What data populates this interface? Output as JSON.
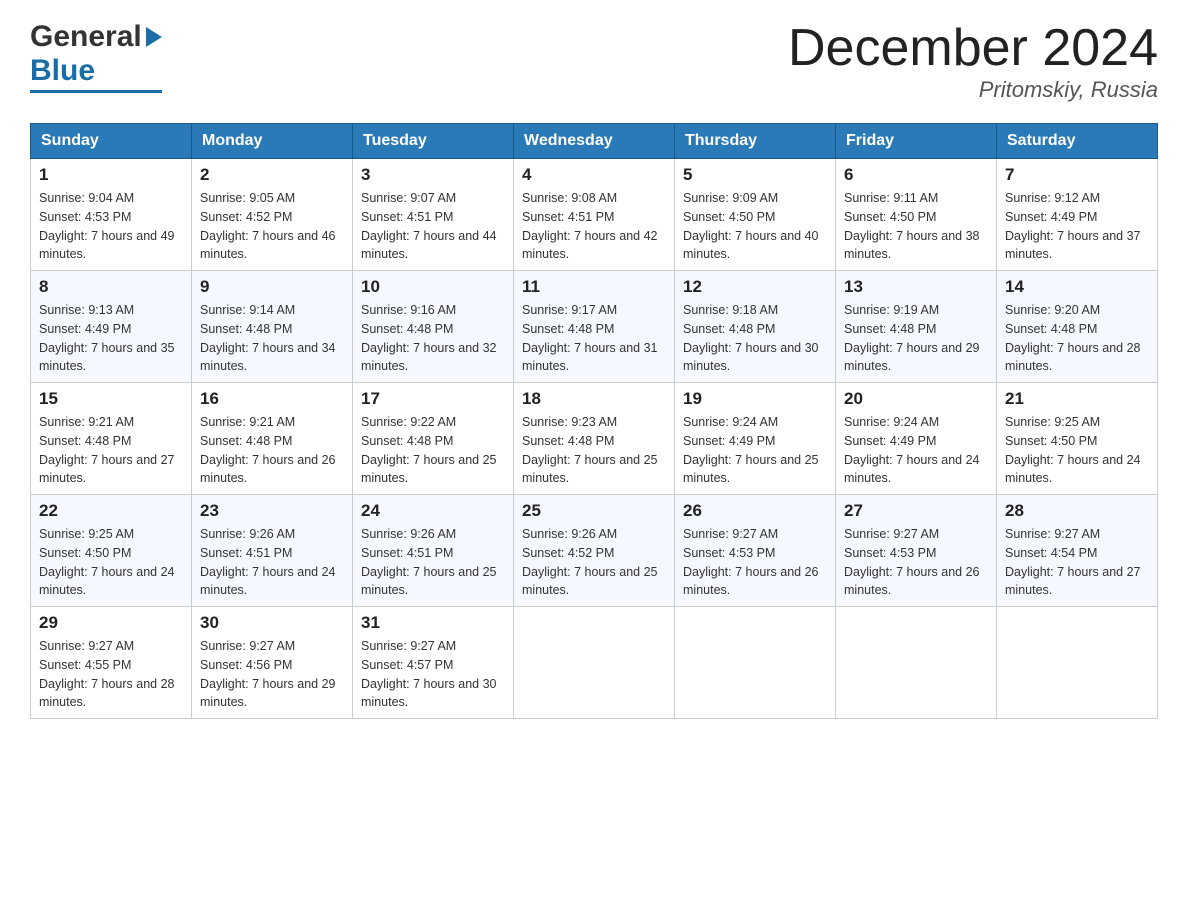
{
  "header": {
    "logo_general": "General",
    "logo_blue": "Blue",
    "month_title": "December 2024",
    "location": "Pritomskiy, Russia"
  },
  "days_of_week": [
    "Sunday",
    "Monday",
    "Tuesday",
    "Wednesday",
    "Thursday",
    "Friday",
    "Saturday"
  ],
  "weeks": [
    [
      {
        "date": "1",
        "sunrise": "Sunrise: 9:04 AM",
        "sunset": "Sunset: 4:53 PM",
        "daylight": "Daylight: 7 hours and 49 minutes."
      },
      {
        "date": "2",
        "sunrise": "Sunrise: 9:05 AM",
        "sunset": "Sunset: 4:52 PM",
        "daylight": "Daylight: 7 hours and 46 minutes."
      },
      {
        "date": "3",
        "sunrise": "Sunrise: 9:07 AM",
        "sunset": "Sunset: 4:51 PM",
        "daylight": "Daylight: 7 hours and 44 minutes."
      },
      {
        "date": "4",
        "sunrise": "Sunrise: 9:08 AM",
        "sunset": "Sunset: 4:51 PM",
        "daylight": "Daylight: 7 hours and 42 minutes."
      },
      {
        "date": "5",
        "sunrise": "Sunrise: 9:09 AM",
        "sunset": "Sunset: 4:50 PM",
        "daylight": "Daylight: 7 hours and 40 minutes."
      },
      {
        "date": "6",
        "sunrise": "Sunrise: 9:11 AM",
        "sunset": "Sunset: 4:50 PM",
        "daylight": "Daylight: 7 hours and 38 minutes."
      },
      {
        "date": "7",
        "sunrise": "Sunrise: 9:12 AM",
        "sunset": "Sunset: 4:49 PM",
        "daylight": "Daylight: 7 hours and 37 minutes."
      }
    ],
    [
      {
        "date": "8",
        "sunrise": "Sunrise: 9:13 AM",
        "sunset": "Sunset: 4:49 PM",
        "daylight": "Daylight: 7 hours and 35 minutes."
      },
      {
        "date": "9",
        "sunrise": "Sunrise: 9:14 AM",
        "sunset": "Sunset: 4:48 PM",
        "daylight": "Daylight: 7 hours and 34 minutes."
      },
      {
        "date": "10",
        "sunrise": "Sunrise: 9:16 AM",
        "sunset": "Sunset: 4:48 PM",
        "daylight": "Daylight: 7 hours and 32 minutes."
      },
      {
        "date": "11",
        "sunrise": "Sunrise: 9:17 AM",
        "sunset": "Sunset: 4:48 PM",
        "daylight": "Daylight: 7 hours and 31 minutes."
      },
      {
        "date": "12",
        "sunrise": "Sunrise: 9:18 AM",
        "sunset": "Sunset: 4:48 PM",
        "daylight": "Daylight: 7 hours and 30 minutes."
      },
      {
        "date": "13",
        "sunrise": "Sunrise: 9:19 AM",
        "sunset": "Sunset: 4:48 PM",
        "daylight": "Daylight: 7 hours and 29 minutes."
      },
      {
        "date": "14",
        "sunrise": "Sunrise: 9:20 AM",
        "sunset": "Sunset: 4:48 PM",
        "daylight": "Daylight: 7 hours and 28 minutes."
      }
    ],
    [
      {
        "date": "15",
        "sunrise": "Sunrise: 9:21 AM",
        "sunset": "Sunset: 4:48 PM",
        "daylight": "Daylight: 7 hours and 27 minutes."
      },
      {
        "date": "16",
        "sunrise": "Sunrise: 9:21 AM",
        "sunset": "Sunset: 4:48 PM",
        "daylight": "Daylight: 7 hours and 26 minutes."
      },
      {
        "date": "17",
        "sunrise": "Sunrise: 9:22 AM",
        "sunset": "Sunset: 4:48 PM",
        "daylight": "Daylight: 7 hours and 25 minutes."
      },
      {
        "date": "18",
        "sunrise": "Sunrise: 9:23 AM",
        "sunset": "Sunset: 4:48 PM",
        "daylight": "Daylight: 7 hours and 25 minutes."
      },
      {
        "date": "19",
        "sunrise": "Sunrise: 9:24 AM",
        "sunset": "Sunset: 4:49 PM",
        "daylight": "Daylight: 7 hours and 25 minutes."
      },
      {
        "date": "20",
        "sunrise": "Sunrise: 9:24 AM",
        "sunset": "Sunset: 4:49 PM",
        "daylight": "Daylight: 7 hours and 24 minutes."
      },
      {
        "date": "21",
        "sunrise": "Sunrise: 9:25 AM",
        "sunset": "Sunset: 4:50 PM",
        "daylight": "Daylight: 7 hours and 24 minutes."
      }
    ],
    [
      {
        "date": "22",
        "sunrise": "Sunrise: 9:25 AM",
        "sunset": "Sunset: 4:50 PM",
        "daylight": "Daylight: 7 hours and 24 minutes."
      },
      {
        "date": "23",
        "sunrise": "Sunrise: 9:26 AM",
        "sunset": "Sunset: 4:51 PM",
        "daylight": "Daylight: 7 hours and 24 minutes."
      },
      {
        "date": "24",
        "sunrise": "Sunrise: 9:26 AM",
        "sunset": "Sunset: 4:51 PM",
        "daylight": "Daylight: 7 hours and 25 minutes."
      },
      {
        "date": "25",
        "sunrise": "Sunrise: 9:26 AM",
        "sunset": "Sunset: 4:52 PM",
        "daylight": "Daylight: 7 hours and 25 minutes."
      },
      {
        "date": "26",
        "sunrise": "Sunrise: 9:27 AM",
        "sunset": "Sunset: 4:53 PM",
        "daylight": "Daylight: 7 hours and 26 minutes."
      },
      {
        "date": "27",
        "sunrise": "Sunrise: 9:27 AM",
        "sunset": "Sunset: 4:53 PM",
        "daylight": "Daylight: 7 hours and 26 minutes."
      },
      {
        "date": "28",
        "sunrise": "Sunrise: 9:27 AM",
        "sunset": "Sunset: 4:54 PM",
        "daylight": "Daylight: 7 hours and 27 minutes."
      }
    ],
    [
      {
        "date": "29",
        "sunrise": "Sunrise: 9:27 AM",
        "sunset": "Sunset: 4:55 PM",
        "daylight": "Daylight: 7 hours and 28 minutes."
      },
      {
        "date": "30",
        "sunrise": "Sunrise: 9:27 AM",
        "sunset": "Sunset: 4:56 PM",
        "daylight": "Daylight: 7 hours and 29 minutes."
      },
      {
        "date": "31",
        "sunrise": "Sunrise: 9:27 AM",
        "sunset": "Sunset: 4:57 PM",
        "daylight": "Daylight: 7 hours and 30 minutes."
      },
      null,
      null,
      null,
      null
    ]
  ]
}
